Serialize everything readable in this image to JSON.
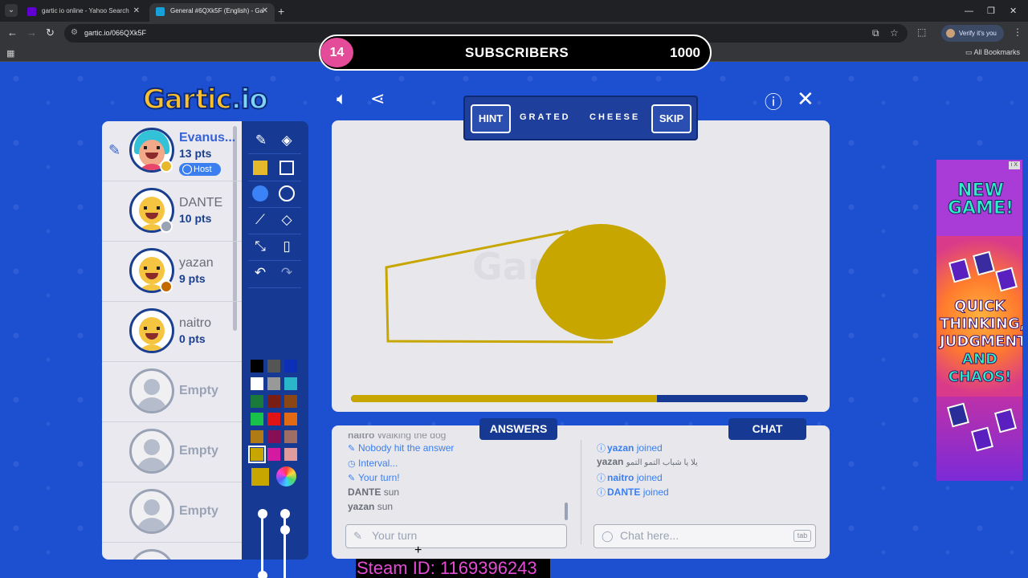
{
  "browser": {
    "tabs": [
      {
        "title": "gartic io online - Yahoo Search"
      },
      {
        "title": "General #6QXk5F (English) - Ga"
      }
    ],
    "url": "gartic.io/066QXk5F",
    "verify_label": "Verify it's you",
    "bookmarks_label": "All Bookmarks"
  },
  "overlay": {
    "subscriber_count": "14",
    "label": "SUBSCRIBERS",
    "goal": "1000",
    "steam_id": "Steam ID: 1169396243"
  },
  "game": {
    "logo": "Gartic",
    "logo_suffix": ".io",
    "hint_label": "HINT",
    "skip_label": "SKIP",
    "word": [
      "GRATED",
      "CHEESE"
    ],
    "progress": 0.67,
    "players": [
      {
        "name": "Evanus...",
        "points": "13 pts",
        "host": "Host",
        "status_color": "#e6b82b"
      },
      {
        "name": "DANTE",
        "points": "10 pts",
        "status_color": "#9aa3b5"
      },
      {
        "name": "yazan",
        "points": "9 pts",
        "status_color": "#c26a00"
      },
      {
        "name": "naitro",
        "points": "0 pts"
      },
      {
        "name": "Empty"
      },
      {
        "name": "Empty"
      },
      {
        "name": "Empty"
      }
    ],
    "palette": [
      "#000000",
      "#555555",
      "#0d2fb8",
      "#ffffff",
      "#999999",
      "#2ab5c9",
      "#1a7a3b",
      "#7a1d14",
      "#8a4614",
      "#19c24a",
      "#e01414",
      "#e06b14",
      "#b07a14",
      "#880f55",
      "#9e6d66",
      "#c7a600",
      "#d41aa0",
      "#e09c9c"
    ],
    "current_color": "#c7a600",
    "answers_tab": "ANSWERS",
    "chat_tab": "CHAT",
    "answers": [
      {
        "user": "naitro",
        "text": "Walking the dog",
        "type": "guess"
      },
      {
        "text": "Nobody hit the answer",
        "type": "system",
        "icon": "pencil"
      },
      {
        "text": "Interval...",
        "type": "system",
        "icon": "clock"
      },
      {
        "text": "Your turn!",
        "type": "system",
        "icon": "pencil"
      },
      {
        "user": "DANTE",
        "text": "sun",
        "type": "guess"
      },
      {
        "user": "yazan",
        "text": "sun",
        "type": "guess"
      }
    ],
    "chat": [
      {
        "user": "yazan",
        "text": "joined",
        "type": "system"
      },
      {
        "user": "yazan",
        "text": "يلا يا شباب التمو التمو",
        "type": "message"
      },
      {
        "user": "naitro",
        "text": "joined",
        "type": "system"
      },
      {
        "user": "DANTE",
        "text": "joined",
        "type": "system"
      }
    ],
    "answer_placeholder": "Your turn",
    "chat_placeholder": "Chat here...",
    "tab_key": "tab"
  },
  "ad": {
    "headline": "NEW GAME!",
    "lines": [
      "QUICK",
      "THINKING,",
      "JUDGMENT",
      "AND",
      "CHAOS!"
    ],
    "corner": "i X"
  }
}
